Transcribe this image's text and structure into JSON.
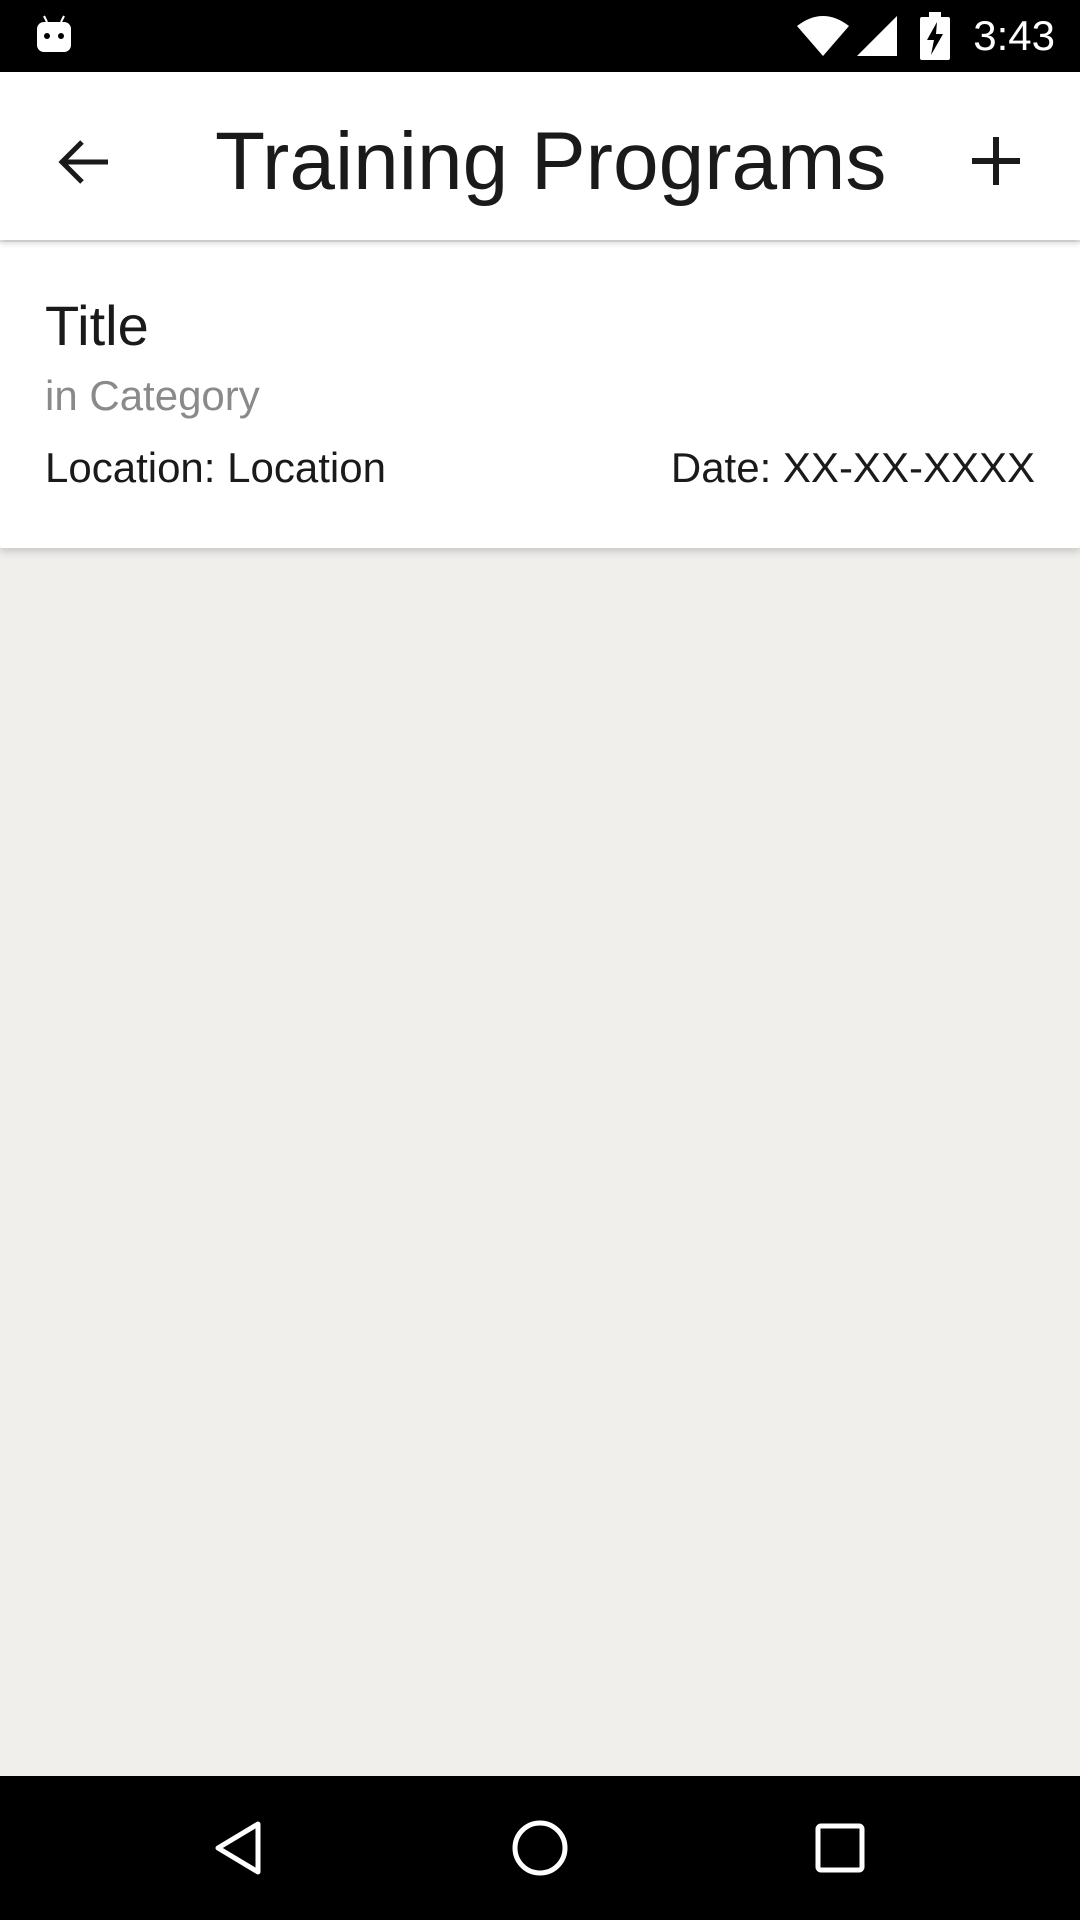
{
  "status_bar": {
    "time": "3:43",
    "icons": [
      "android-icon",
      "wifi-icon",
      "signal-icon",
      "battery-charging-icon"
    ]
  },
  "app_bar": {
    "title": "Training Programs",
    "back_icon": "arrow-back-icon",
    "add_icon": "plus-icon"
  },
  "programs": [
    {
      "title": "Title",
      "category": "in Category",
      "location": "Location: Location",
      "date": "Date: XX-XX-XXXX"
    }
  ],
  "nav_bar": {
    "icons": [
      "nav-back-icon",
      "nav-home-icon",
      "nav-recents-icon"
    ]
  },
  "colors": {
    "status_bar_bg": "#000000",
    "app_bar_bg": "#ffffff",
    "background": "#f0efec",
    "card_bg": "#ffffff",
    "primary_text": "#1a1a1a",
    "secondary_text": "#8a8a8a",
    "nav_bar_bg": "#000000"
  }
}
